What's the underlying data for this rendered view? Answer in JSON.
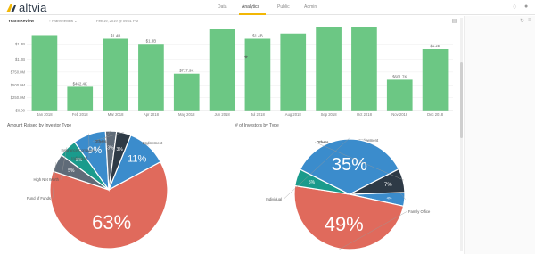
{
  "app": {
    "logo": "altvia"
  },
  "nav": [
    {
      "label": "Data",
      "active": false
    },
    {
      "label": "Analytics",
      "active": true
    },
    {
      "label": "Public",
      "active": false
    },
    {
      "label": "Admin",
      "active": false
    }
  ],
  "topbar_icons": [
    "bell-icon",
    "user-icon"
  ],
  "report": {
    "title": "YearInReview",
    "chip": "YearInReview",
    "date": "Feb 19, 2019 @ 09:51 PM"
  },
  "colors": {
    "bar": "#6cc784",
    "accent": "#f2b705",
    "red": "#e06a5c",
    "blue": "#3b8ccc",
    "teal": "#1a9b8c",
    "gray": "#5f6b78",
    "dark": "#2e3a46"
  },
  "chart_data": [
    {
      "type": "bar",
      "categories": [
        "Jan 2018",
        "Feb 2018",
        "Mar 2018",
        "Apr 2018",
        "May 2018",
        "Jun 2018",
        "Jul 2018",
        "Aug 2018",
        "Sep 2018",
        "Oct 2018",
        "Nov 2018",
        "Dec 2018"
      ],
      "values": [
        1.47,
        0.4624,
        1.4,
        1.3,
        0.7179,
        1.6,
        1.4,
        1.5,
        1.7,
        1.7,
        0.6017,
        1.2
      ],
      "data_labels": [
        "",
        "$462.4K",
        "$1.4B",
        "$1.3B",
        "$717.9K",
        "",
        "$1.4B",
        "",
        "",
        "$1.7B",
        "$601.7K",
        "$1.2B"
      ],
      "y_ticks": [
        "$0.00",
        "$250.0M",
        "$500.0M",
        "$750.0M",
        "$1.0B",
        "$1.3B"
      ],
      "ylim": [
        0,
        1.6
      ]
    },
    {
      "type": "pie",
      "title": "Amount Raised by Investor Type",
      "slices": [
        {
          "label": "Endowment",
          "value": 11,
          "text": "11%",
          "color": "#3b8ccc"
        },
        {
          "label": "",
          "value": 63,
          "text": "63%",
          "color": "#e06a5c"
        },
        {
          "label": "Fund of Funds",
          "value": 5,
          "text": "5%",
          "color": "#5f6b78"
        },
        {
          "label": "High Net Worth",
          "value": 5,
          "text": "5%",
          "color": "#1a9b8c"
        },
        {
          "label": "Individual",
          "value": 9,
          "text": "9%",
          "color": "#3b8ccc"
        },
        {
          "label": "Insurance Company",
          "value": 3,
          "text": "3%",
          "color": "#5f6b78"
        },
        {
          "label": "Others",
          "value": 4,
          "text": "3%",
          "color": "#2e3a46"
        }
      ]
    },
    {
      "type": "pie",
      "title": "# of Investors by Type",
      "slices": [
        {
          "label": "Endowment",
          "value": 4,
          "text": "4%",
          "color": "#3b8ccc"
        },
        {
          "label": "Family Office",
          "value": 49,
          "text": "49%",
          "color": "#e06a5c"
        },
        {
          "label": "",
          "value": 5,
          "text": "5%",
          "color": "#1a9b8c"
        },
        {
          "label": "Individual",
          "value": 35,
          "text": "35%",
          "color": "#3b8ccc"
        },
        {
          "label": "Others",
          "value": 7,
          "text": "7%",
          "color": "#2e3a46"
        }
      ]
    }
  ]
}
